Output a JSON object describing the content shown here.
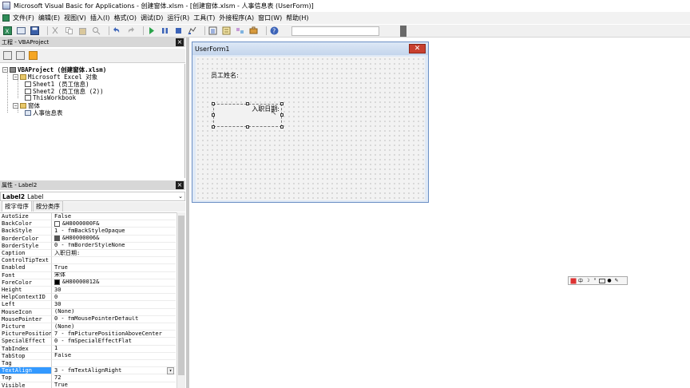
{
  "window": {
    "title": "Microsoft Visual Basic for Applications - 创建窗体.xlsm - [创建窗体.xlsm - 人事信息表 (UserForm)]"
  },
  "menu": [
    "文件(F)",
    "编辑(E)",
    "视图(V)",
    "插入(I)",
    "格式(O)",
    "调试(D)",
    "运行(R)",
    "工具(T)",
    "外接程序(A)",
    "窗口(W)",
    "帮助(H)"
  ],
  "toolbar": {
    "icons": [
      "excel-icon",
      "insert-form-icon",
      "save-icon",
      "cut-icon",
      "copy-icon",
      "paste-icon",
      "find-icon",
      "undo-icon",
      "redo-icon",
      "run-icon",
      "break-icon",
      "reset-icon",
      "design-mode-icon",
      "project-explorer-icon",
      "properties-icon",
      "object-browser-icon",
      "toolbox-icon",
      "help-icon"
    ]
  },
  "project": {
    "header": "工程 - VBAProject",
    "tree": {
      "root": "VBAProject (创建窗体.xlsm)",
      "excel_objects": "Microsoft Excel 对象",
      "sheet1": "Sheet1 (员工信息)",
      "sheet2": "Sheet2 (员工信息 (2))",
      "workbook": "ThisWorkbook",
      "forms_folder": "窗体",
      "form1": "人事信息表"
    }
  },
  "properties": {
    "header": "属性 - Label2",
    "object_name": "Label2",
    "object_type": "Label",
    "tabs": [
      "按字母序",
      "按分类序"
    ],
    "rows": [
      {
        "name": "AutoSize",
        "value": "False"
      },
      {
        "name": "BackColor",
        "value": "&H8000000F&",
        "swatch": "#ffffff"
      },
      {
        "name": "BackStyle",
        "value": "1 - fmBackStyleOpaque"
      },
      {
        "name": "BorderColor",
        "value": "&H80000006&",
        "swatch": "#555555"
      },
      {
        "name": "BorderStyle",
        "value": "0 - fmBorderStyleNone"
      },
      {
        "name": "Caption",
        "value": "入职日期:"
      },
      {
        "name": "ControlTipText",
        "value": ""
      },
      {
        "name": "Enabled",
        "value": "True"
      },
      {
        "name": "Font",
        "value": "宋体"
      },
      {
        "name": "ForeColor",
        "value": "&H80000012&",
        "swatch": "#000000"
      },
      {
        "name": "Height",
        "value": "30"
      },
      {
        "name": "HelpContextID",
        "value": "0"
      },
      {
        "name": "Left",
        "value": "30"
      },
      {
        "name": "MouseIcon",
        "value": "(None)"
      },
      {
        "name": "MousePointer",
        "value": "0 - fmMousePointerDefault"
      },
      {
        "name": "Picture",
        "value": "(None)"
      },
      {
        "name": "PicturePosition",
        "value": "7 - fmPicturePositionAboveCenter"
      },
      {
        "name": "SpecialEffect",
        "value": "0 - fmSpecialEffectFlat"
      },
      {
        "name": "TabIndex",
        "value": "1"
      },
      {
        "name": "TabStop",
        "value": "False"
      },
      {
        "name": "Tag",
        "value": ""
      },
      {
        "name": "TextAlign",
        "value": "3 - fmTextAlignRight",
        "selected": true
      },
      {
        "name": "Top",
        "value": "72"
      },
      {
        "name": "Visible",
        "value": "True"
      }
    ]
  },
  "designer": {
    "title": "UserForm1",
    "label1": "员工姓名:",
    "label2": "入职日期:"
  },
  "ime": {
    "icons": [
      "ime-logo-icon",
      "chinese-mode-icon",
      "moon-icon",
      "punctuation-icon",
      "keyboard-icon",
      "user-icon",
      "wrench-icon"
    ],
    "mode": "中"
  }
}
